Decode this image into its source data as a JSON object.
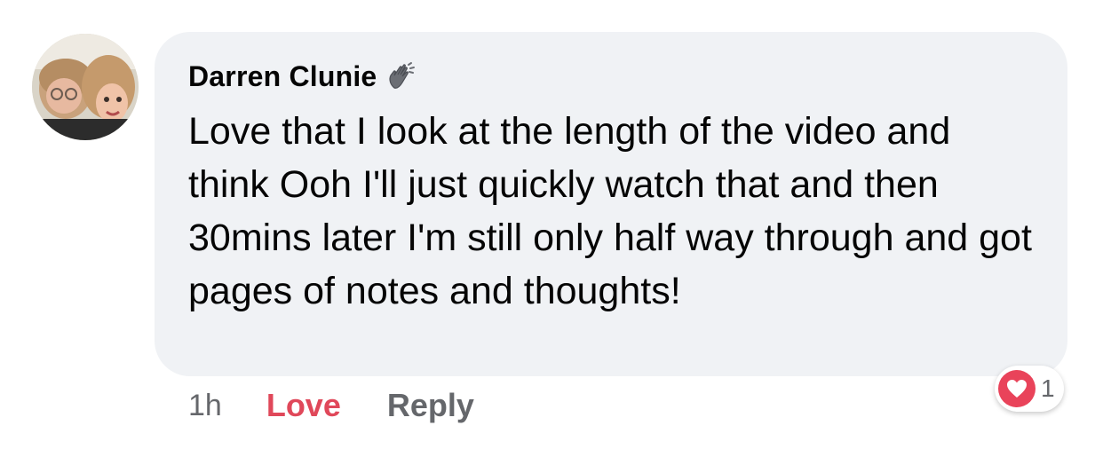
{
  "comment": {
    "author": "Darren Clunie",
    "author_badge_icon": "waving-hand-icon",
    "text": "Love that I look at the length of the video and think Ooh I'll just quickly watch that and then 30mins later I'm still only half way through and got pages of notes and thoughts!"
  },
  "actions": {
    "time": "1h",
    "love_label": "Love",
    "reply_label": "Reply"
  },
  "reactions": {
    "icon": "heart-icon",
    "count": "1"
  },
  "colors": {
    "bubble": "#f0f2f5",
    "love_active": "#e0485a",
    "heart": "#e9435a",
    "muted": "#65676b"
  }
}
